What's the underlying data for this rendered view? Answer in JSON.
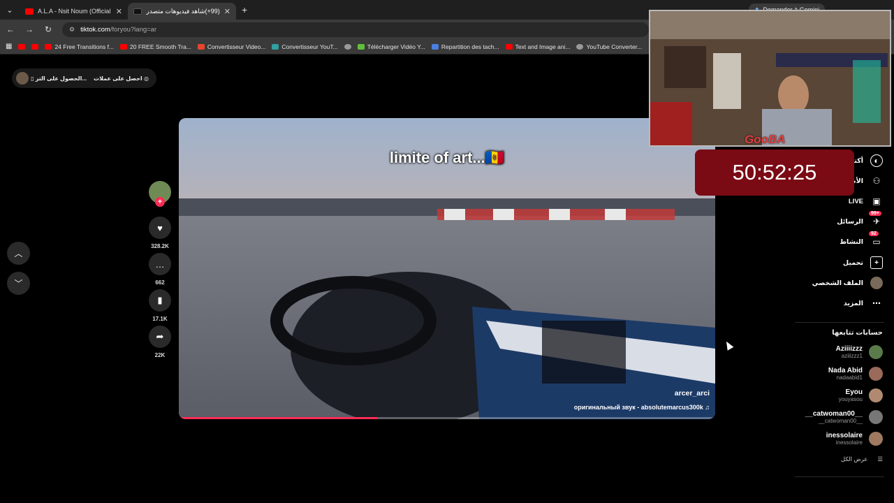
{
  "browser": {
    "tabs": [
      {
        "title": "A.L.A - Nsit Noum (Official Mus",
        "favicon_color": "#ff0000",
        "active": false
      },
      {
        "title": "(99+)شاهد فيديوهات متصدر",
        "favicon_color": "#111111",
        "active": true
      }
    ],
    "gemini_label": "Demander à Gemini",
    "url_host": "tiktok.com",
    "url_path": "/foryou?lang=ar",
    "bookmarks": [
      {
        "label": "",
        "color": "#ff0000"
      },
      {
        "label": "",
        "color": "#ff0000"
      },
      {
        "label": "24 Free Transitions f...",
        "color": "#ff0000"
      },
      {
        "label": "20 FREE Smooth Tra...",
        "color": "#ff0000"
      },
      {
        "label": "Convertisseur Video...",
        "color": "#e8452c"
      },
      {
        "label": "Convertisseur YouT...",
        "color": "#30a0a0"
      },
      {
        "label": "",
        "color": "#999999"
      },
      {
        "label": "Télécharger Vidéo Y...",
        "color": "#5fbf3a"
      },
      {
        "label": "Repartition des tach...",
        "color": "#4a7fe0"
      },
      {
        "label": "Text and Image ani...",
        "color": "#ff0000"
      },
      {
        "label": "YouTube Converter...",
        "color": "#999999"
      }
    ]
  },
  "coins": {
    "label_get": "الحصول على التر...",
    "label_earn": "احصل على عملات"
  },
  "video": {
    "caption": "limite of art...🇲🇩",
    "author": "arcer_arci",
    "sound": "оригинальный звук - absolutemarcus300k ♫",
    "progress_fraction": 0.37
  },
  "actions": {
    "likes": "328.2K",
    "comments": "662",
    "saves": "17.1K",
    "shares": "22K"
  },
  "overlay": {
    "streamer_name": "GooBA",
    "timer": "50:52:25"
  },
  "sidenav": {
    "items": [
      {
        "label": "أكتشف",
        "icon": "explore-icon"
      },
      {
        "label": "الأصدقاء",
        "icon": "friends-icon"
      },
      {
        "label": "LIVE",
        "icon": "live-icon"
      },
      {
        "label": "الرسائل",
        "icon": "messages-icon",
        "badge": "99+"
      },
      {
        "label": "النشاط",
        "icon": "activity-icon",
        "badge": "92"
      },
      {
        "label": "تحميل",
        "icon": "upload-icon"
      },
      {
        "label": "الملف الشخصي",
        "icon": "profile-icon"
      },
      {
        "label": "المزيد",
        "icon": "more-icon"
      }
    ],
    "following_title": "حسابات تتابعها",
    "following": [
      {
        "name": "Aziiiizzz",
        "handle": "aziiizzz1",
        "color": "#5a7a4a"
      },
      {
        "name": "Nada Abid",
        "handle": "nadaabid1",
        "color": "#9a6a5a"
      },
      {
        "name": "Eyou",
        "handle": "youyasou",
        "color": "#b08a70"
      },
      {
        "name": "__catwoman00__",
        "handle": "__catwoman00__",
        "color": "#777777"
      },
      {
        "name": "inessolaire",
        "handle": "inessolaire",
        "color": "#a07a60"
      }
    ],
    "see_all": "عرض الكل"
  }
}
